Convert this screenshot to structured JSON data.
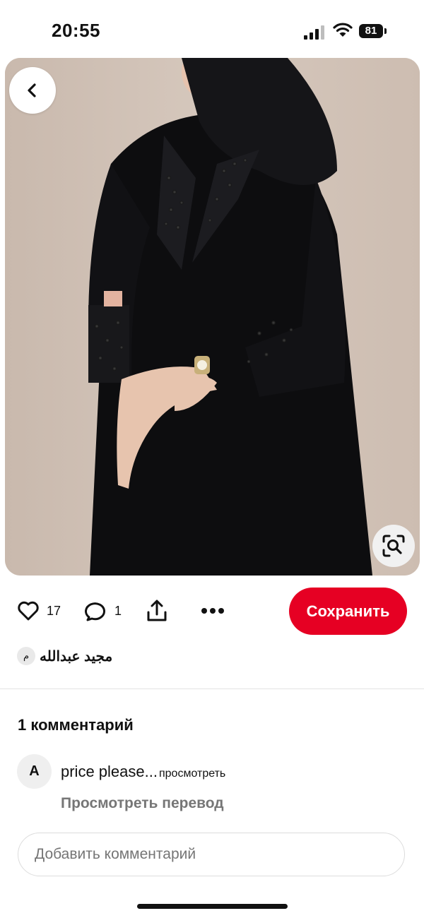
{
  "status_bar": {
    "time": "20:55",
    "battery": "81"
  },
  "pin": {
    "likes": "17",
    "comments_count": "1",
    "save_label": "Сохранить",
    "author_initial": "م",
    "author_name": "مجيد عبدالله"
  },
  "comments": {
    "title": "1 комментарий",
    "items": [
      {
        "initial": "A",
        "text": "price please",
        "ellipsis": "...",
        "more_label": "просмотреть"
      }
    ],
    "translate_label": "Просмотреть перевод",
    "add_placeholder": "Добавить комментарий"
  },
  "icons": {
    "back": "chevron-left-icon",
    "lens": "visual-search-icon",
    "like": "heart-icon",
    "comment": "comment-bubble-icon",
    "share": "share-icon",
    "more": "more-dots-icon"
  },
  "colors": {
    "save_button": "#e60023",
    "translate_text": "#767676"
  }
}
